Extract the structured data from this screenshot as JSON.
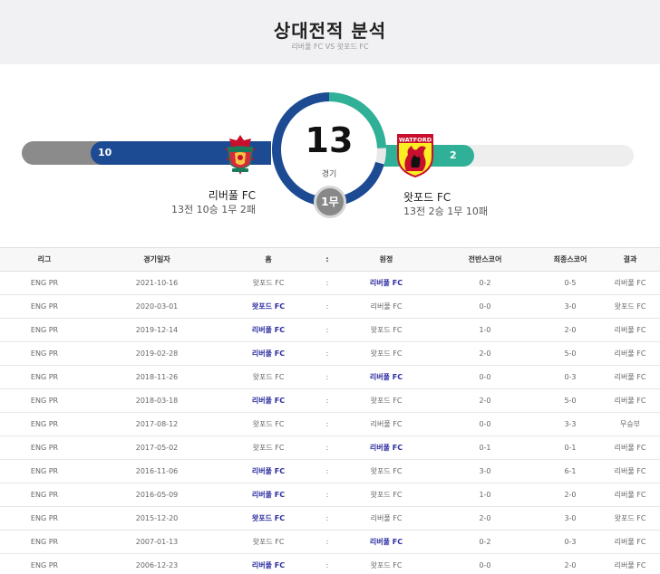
{
  "header": {
    "title": "상대전적 분석",
    "subtitle": "리버풀 FC VS 왓포드 FC"
  },
  "summary": {
    "total": "13",
    "total_label": "경기",
    "home_wins": "10",
    "away_wins": "2",
    "draws": "1무",
    "home_win_count": 10,
    "draw_count": 1,
    "away_win_count": 2,
    "home_team": {
      "name": "리버풀 FC",
      "record": "13전 10승 1무 2패",
      "crest": "liverpool-crest-icon"
    },
    "away_team": {
      "name": "왓포드 FC",
      "record": "13전 2승 1무 10패",
      "crest": "watford-crest-icon",
      "crest_text": "WATFORD"
    }
  },
  "colors": {
    "home": "#1d4b93",
    "away": "#2fb097",
    "draw": "#888888",
    "winner_text": "#2b2ba0"
  },
  "table": {
    "headers": [
      "리그",
      "경기일자",
      "홈",
      ":",
      "원정",
      "전반스코어",
      "최종스코어",
      "결과"
    ],
    "rows": [
      {
        "league": "ENG PR",
        "date": "2021-10-16",
        "home": "왓포드 FC",
        "sep": ":",
        "away": "리버풀 FC",
        "half": "0-2",
        "final": "0-5",
        "result": "리버풀 FC",
        "winner": "away"
      },
      {
        "league": "ENG PR",
        "date": "2020-03-01",
        "home": "왓포드 FC",
        "sep": ":",
        "away": "리버풀 FC",
        "half": "0-0",
        "final": "3-0",
        "result": "왓포드 FC",
        "winner": "home"
      },
      {
        "league": "ENG PR",
        "date": "2019-12-14",
        "home": "리버풀 FC",
        "sep": ":",
        "away": "왓포드 FC",
        "half": "1-0",
        "final": "2-0",
        "result": "리버풀 FC",
        "winner": "home"
      },
      {
        "league": "ENG PR",
        "date": "2019-02-28",
        "home": "리버풀 FC",
        "sep": ":",
        "away": "왓포드 FC",
        "half": "2-0",
        "final": "5-0",
        "result": "리버풀 FC",
        "winner": "home"
      },
      {
        "league": "ENG PR",
        "date": "2018-11-26",
        "home": "왓포드 FC",
        "sep": ":",
        "away": "리버풀 FC",
        "half": "0-0",
        "final": "0-3",
        "result": "리버풀 FC",
        "winner": "away"
      },
      {
        "league": "ENG PR",
        "date": "2018-03-18",
        "home": "리버풀 FC",
        "sep": ":",
        "away": "왓포드 FC",
        "half": "2-0",
        "final": "5-0",
        "result": "리버풀 FC",
        "winner": "home"
      },
      {
        "league": "ENG PR",
        "date": "2017-08-12",
        "home": "왓포드 FC",
        "sep": ":",
        "away": "리버풀 FC",
        "half": "0-0",
        "final": "3-3",
        "result": "무승부",
        "winner": "none"
      },
      {
        "league": "ENG PR",
        "date": "2017-05-02",
        "home": "왓포드 FC",
        "sep": ":",
        "away": "리버풀 FC",
        "half": "0-1",
        "final": "0-1",
        "result": "리버풀 FC",
        "winner": "away"
      },
      {
        "league": "ENG PR",
        "date": "2016-11-06",
        "home": "리버풀 FC",
        "sep": ":",
        "away": "왓포드 FC",
        "half": "3-0",
        "final": "6-1",
        "result": "리버풀 FC",
        "winner": "home"
      },
      {
        "league": "ENG PR",
        "date": "2016-05-09",
        "home": "리버풀 FC",
        "sep": ":",
        "away": "왓포드 FC",
        "half": "1-0",
        "final": "2-0",
        "result": "리버풀 FC",
        "winner": "home"
      },
      {
        "league": "ENG PR",
        "date": "2015-12-20",
        "home": "왓포드 FC",
        "sep": ":",
        "away": "리버풀 FC",
        "half": "2-0",
        "final": "3-0",
        "result": "왓포드 FC",
        "winner": "home"
      },
      {
        "league": "ENG PR",
        "date": "2007-01-13",
        "home": "왓포드 FC",
        "sep": ":",
        "away": "리버풀 FC",
        "half": "0-2",
        "final": "0-3",
        "result": "리버풀 FC",
        "winner": "away"
      },
      {
        "league": "ENG PR",
        "date": "2006-12-23",
        "home": "리버풀 FC",
        "sep": ":",
        "away": "왓포드 FC",
        "half": "0-0",
        "final": "2-0",
        "result": "리버풀 FC",
        "winner": "home"
      }
    ]
  }
}
